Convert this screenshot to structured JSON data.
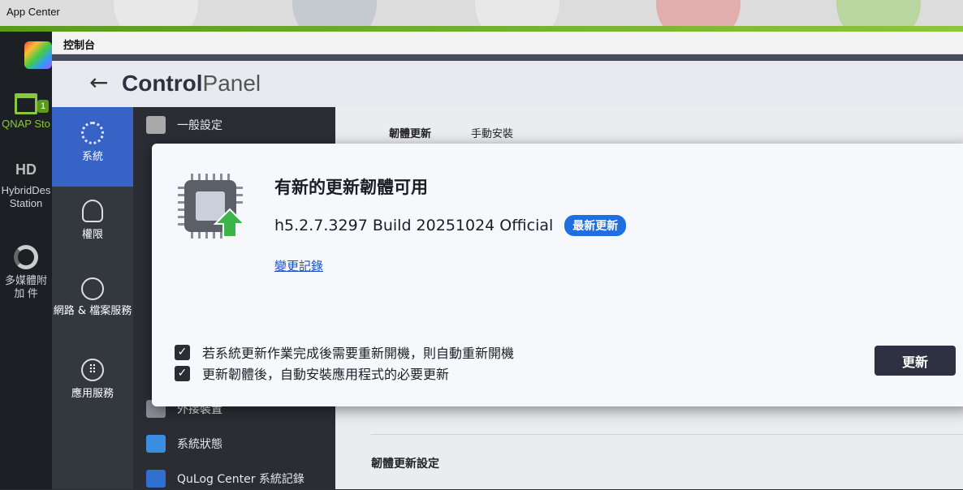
{
  "appbar": {
    "title": "App Center"
  },
  "window": {
    "title": "控制台"
  },
  "header": {
    "logo_bold": "Control",
    "logo_light": "Panel"
  },
  "leftrail": {
    "items": [
      {
        "label": "QNAP Sto",
        "badge": "1"
      },
      {
        "label": "HybridDes Station"
      },
      {
        "label": "多媒體附加 件"
      }
    ]
  },
  "categories": [
    {
      "label": "系統",
      "icon": "gear-icon"
    },
    {
      "label": "權限",
      "icon": "user-icon"
    },
    {
      "label": "網路 & 檔案服務",
      "icon": "globe-icon"
    },
    {
      "label": "應用服務",
      "icon": "grid-icon"
    }
  ],
  "subitems": [
    {
      "label": "一般設定"
    },
    {
      "label": "外接裝置"
    },
    {
      "label": "系統狀態"
    },
    {
      "label": "QuLog Center 系統記錄"
    }
  ],
  "tabs": {
    "active": "韌體更新",
    "other": "手動安裝"
  },
  "section": {
    "title": "韌體更新設定"
  },
  "modal": {
    "title": "有新的更新韌體可用",
    "version": "h5.2.7.3297 Build 20251024 Official",
    "badge": "最新更新",
    "link": "變更記錄",
    "checkbox1": "若系統更新作業完成後需要重新開機，則自動重新開機",
    "checkbox2": "更新韌體後，自動安裝應用程式的必要更新",
    "update_button": "更新"
  },
  "colors": {
    "accent": "#1f6fe0",
    "active_category": "#3663c5",
    "green": "#8cc63f"
  }
}
